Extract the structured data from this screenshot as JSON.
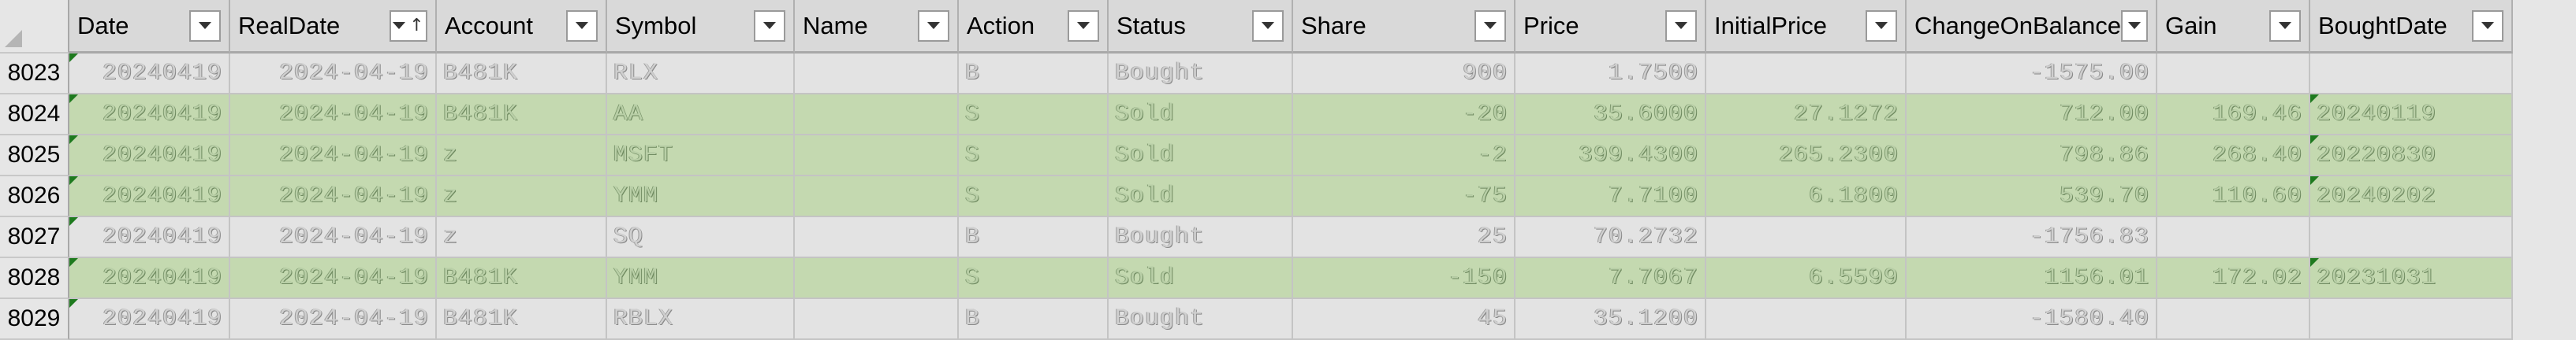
{
  "columns": [
    {
      "name": "Date",
      "sorted": false
    },
    {
      "name": "RealDate",
      "sorted": true
    },
    {
      "name": "Account",
      "sorted": false
    },
    {
      "name": "Symbol",
      "sorted": false
    },
    {
      "name": "Name",
      "sorted": false
    },
    {
      "name": "Action",
      "sorted": false
    },
    {
      "name": "Status",
      "sorted": false
    },
    {
      "name": "Share",
      "sorted": false
    },
    {
      "name": "Price",
      "sorted": false
    },
    {
      "name": "InitialPrice",
      "sorted": false
    },
    {
      "name": "ChangeOnBalance",
      "sorted": false
    },
    {
      "name": "Gain",
      "sorted": false
    },
    {
      "name": "BoughtDate",
      "sorted": false
    }
  ],
  "icons": {
    "filter": "dropdown-filter-icon",
    "sort": "sort-ascending-icon",
    "error": "error-indicator-icon"
  },
  "colors": {
    "highlight": "#c4d9b0",
    "normal": "#e3e3e3",
    "indicator": "#1e7a1e"
  },
  "rows": [
    {
      "num": "8023",
      "highlight": false,
      "cells": [
        "20240419",
        "2024-04-19",
        "B481K",
        "RLX",
        "",
        "B",
        "Bought",
        "900",
        "1.7500",
        "",
        "-1575.00",
        "",
        ""
      ]
    },
    {
      "num": "8024",
      "highlight": true,
      "cells": [
        "20240419",
        "2024-04-19",
        "B481K",
        "AA",
        "",
        "S",
        "Sold",
        "-20",
        "35.6000",
        "27.1272",
        "712.00",
        "169.46",
        "20240119"
      ]
    },
    {
      "num": "8025",
      "highlight": true,
      "cells": [
        "20240419",
        "2024-04-19",
        "z",
        "MSFT",
        "",
        "S",
        "Sold",
        "-2",
        "399.4300",
        "265.2300",
        "798.86",
        "268.40",
        "20220830"
      ]
    },
    {
      "num": "8026",
      "highlight": true,
      "cells": [
        "20240419",
        "2024-04-19",
        "z",
        "YMM",
        "",
        "S",
        "Sold",
        "-75",
        "7.7100",
        "6.1800",
        "539.70",
        "110.60",
        "20240202"
      ]
    },
    {
      "num": "8027",
      "highlight": false,
      "cells": [
        "20240419",
        "2024-04-19",
        "z",
        "SQ",
        "",
        "B",
        "Bought",
        "25",
        "70.2732",
        "",
        "-1756.83",
        "",
        ""
      ]
    },
    {
      "num": "8028",
      "highlight": true,
      "cells": [
        "20240419",
        "2024-04-19",
        "B481K",
        "YMM",
        "",
        "S",
        "Sold",
        "-150",
        "7.7067",
        "6.5599",
        "1156.01",
        "172.02",
        "20231031"
      ]
    },
    {
      "num": "8029",
      "highlight": false,
      "cells": [
        "20240419",
        "2024-04-19",
        "B481K",
        "RBLX",
        "",
        "B",
        "Bought",
        "45",
        "35.1200",
        "",
        "-1580.40",
        "",
        ""
      ]
    }
  ]
}
